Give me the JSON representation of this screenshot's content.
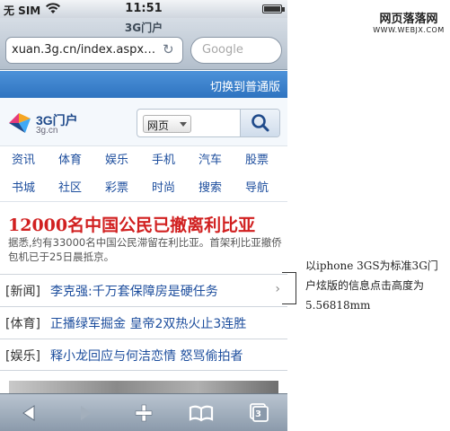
{
  "statusbar": {
    "carrier": "无 SIM",
    "time": "11:51"
  },
  "browser": {
    "page_title": "3G门户",
    "url": "xuan.3g.cn/index.aspx…",
    "search_placeholder": "Google"
  },
  "switch_link": "切换到普通版",
  "site": {
    "brand": "3G门户",
    "domain": "3g.cn",
    "search_select": "网页"
  },
  "nav": {
    "row1": [
      "资讯",
      "体育",
      "娱乐",
      "手机",
      "汽车",
      "股票"
    ],
    "row2": [
      "书城",
      "社区",
      "彩票",
      "时尚",
      "搜索",
      "导航"
    ]
  },
  "headline": {
    "title": "12000名中国公民已撤离利比亚",
    "summary": "据悉,约有33000名中国公民滞留在利比亚。首架利比亚撤侨包机已于25日晨抵京。"
  },
  "news": [
    {
      "tag": "[新闻]",
      "title": "李克强:千万套保障房是硬任务"
    },
    {
      "tag": "[体育]",
      "title": "正播绿军掘金 皇帝2双热火止3连胜"
    },
    {
      "tag": "[娱乐]",
      "title": "释小龙回应与何洁恋情 怒骂偷拍者"
    }
  ],
  "toolbar": {
    "pages_count": "3"
  },
  "watermark": {
    "line1": "网页落落网",
    "line2": "WWW.WEBJX.COM"
  },
  "annotation": "以iphone 3GS为标准3G门户炫版的信息点击高度为5.56818mm",
  "icons": [
    "wifi-icon",
    "battery-icon",
    "reload-icon",
    "search-icon",
    "back-icon",
    "forward-icon",
    "add-icon",
    "bookmarks-icon",
    "pages-icon",
    "chevron-right-icon"
  ],
  "colors": {
    "accent_blue": "#3478c6",
    "headline_red": "#d12020",
    "link_blue": "#1c4d9d"
  }
}
